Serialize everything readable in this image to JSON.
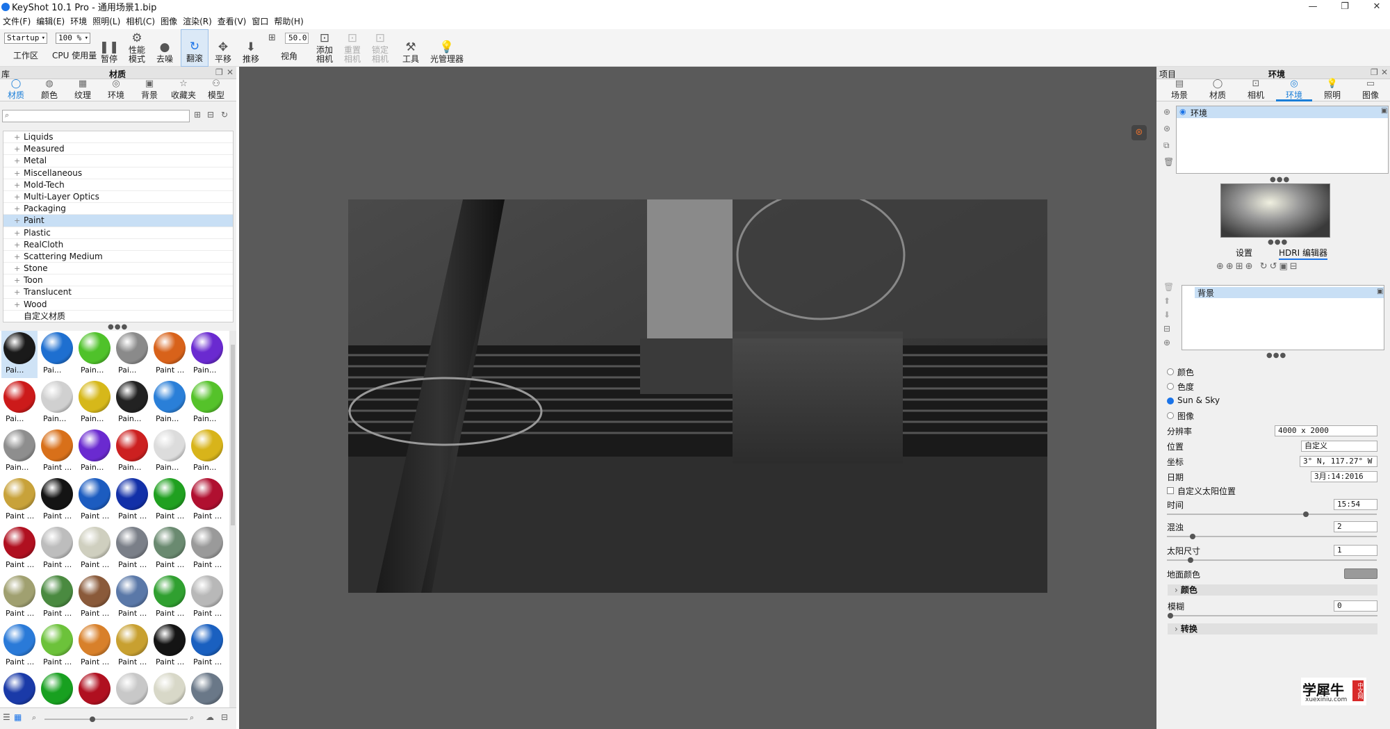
{
  "window": {
    "title": "KeyShot 10.1 Pro  - 通用场景1.bip",
    "min": "—",
    "max": "❐",
    "close": "✕"
  },
  "menu": [
    "文件(F)",
    "编辑(E)",
    "环境",
    "照明(L)",
    "相机(C)",
    "图像",
    "渲染(R)",
    "查看(V)",
    "窗口",
    "帮助(H)"
  ],
  "toolbar": {
    "workspace_value": "Startup",
    "workspace_label": "工作区",
    "cpu_value": "100 %",
    "cpu_label": "CPU 使用量",
    "pause": "暂停",
    "perf": "性能\n模式",
    "denoise": "去噪",
    "tumble": "翻滚",
    "pan": "平移",
    "dolly": "推移",
    "fov_value": "50.0",
    "fov": "视角",
    "add_camera": "添加\n相机",
    "reset_camera": "重置\n相机",
    "lock_camera": "锁定\n相机",
    "tools": "工具",
    "light_manager": "光管理器"
  },
  "left": {
    "lib_label": "库",
    "title": "材质",
    "tabs": [
      "材质",
      "颜色",
      "纹理",
      "环境",
      "背景",
      "收藏夹",
      "模型"
    ],
    "tree": [
      "Liquids",
      "Measured",
      "Metal",
      "Miscellaneous",
      "Mold-Tech",
      "Multi-Layer Optics",
      "Packaging",
      "Paint",
      "Plastic",
      "RealCloth",
      "Scattering Medium",
      "Stone",
      "Toon",
      "Translucent",
      "Wood",
      "自定义材质"
    ],
    "selected_tree": "Paint",
    "thumbs": [
      [
        "Pai...",
        "Pai...",
        "Pain...",
        "Pai...",
        "Paint ...",
        "Pain..."
      ],
      [
        "Pai...",
        "Pain...",
        "Pain...",
        "Pain...",
        "Pain...",
        "Pain..."
      ],
      [
        "Pain...",
        "Paint ...",
        "Pain...",
        "Pain...",
        "Pain...",
        "Pain..."
      ],
      [
        "Paint ...",
        "Paint ...",
        "Paint ...",
        "Paint ...",
        "Paint ...",
        "Paint ..."
      ],
      [
        "Paint ...",
        "Paint ...",
        "Paint ...",
        "Paint ...",
        "Paint ...",
        "Paint ..."
      ],
      [
        "Paint ...",
        "Paint ...",
        "Paint ...",
        "Paint ...",
        "Paint ...",
        "Paint ..."
      ],
      [
        "Paint ...",
        "Paint ...",
        "Paint ...",
        "Paint ...",
        "Paint ...",
        "Paint ..."
      ],
      [
        "",
        "",
        "",
        "",
        "",
        ""
      ]
    ],
    "thumb_colors": [
      [
        "#1a1a1a",
        "#1e6fd0",
        "#4fc22a",
        "#8a8a8a",
        "#d8621a",
        "#6a2ad0"
      ],
      [
        "#cc1a1a",
        "#d0d0d0",
        "#d6b81a",
        "#222222",
        "#2a7fd8",
        "#55c22a"
      ],
      [
        "#8e8e8e",
        "#d8701a",
        "#6a2ad0",
        "#cc2020",
        "#dcdcdc",
        "#d8b41a"
      ],
      [
        "#c8a23a",
        "#141414",
        "#1c5cc0",
        "#1230a8",
        "#20a020",
        "#b01030"
      ],
      [
        "#b01020",
        "#bdbdbd",
        "#cfcfbf",
        "#7a7f88",
        "#6a8a70",
        "#9a9a9a"
      ],
      [
        "#a0a070",
        "#4a8a40",
        "#8a5a3a",
        "#5a78a8",
        "#30a030",
        "#b8b8b8"
      ],
      [
        "#2a7ad8",
        "#6cc23a",
        "#d8802a",
        "#c8a030",
        "#141414",
        "#1a60c0"
      ],
      [
        "#1a3aa8",
        "#18a020",
        "#b01020",
        "#c8c8c8",
        "#d8d8c8",
        "#6a7888"
      ]
    ]
  },
  "right": {
    "project_label": "项目",
    "title": "环境",
    "tabs": [
      "场景",
      "材质",
      "相机",
      "环境",
      "照明",
      "图像"
    ],
    "env_item": "环境",
    "subtabs": [
      "设置",
      "HDRI 编辑器"
    ],
    "bg_item": "背景",
    "radio_labels": [
      "颜色",
      "色度",
      "Sun & Sky",
      "图像"
    ],
    "resolution_label": "分辨率",
    "resolution_value": "4000 x 2000",
    "location_label": "位置",
    "location_value": "自定义",
    "coord_label": "坐标",
    "coord_value": "3° N, 117.27° W",
    "date_label": "日期",
    "date_value": "3月:14:2016",
    "custom_sun": "自定义太阳位置",
    "time_label": "时间",
    "time_value": "15:54",
    "turbidity_label": "混浊",
    "turbidity_value": "2",
    "sunsize_label": "太阳尺寸",
    "sunsize_value": "1",
    "ground_label": "地面颜色",
    "color_section": "颜色",
    "blur_label": "模糊",
    "blur_value": "0",
    "transform_section": "转换"
  },
  "watermark": {
    "brand": "学犀牛",
    "url": "xuexiniu.com",
    "badge": "中文网"
  }
}
